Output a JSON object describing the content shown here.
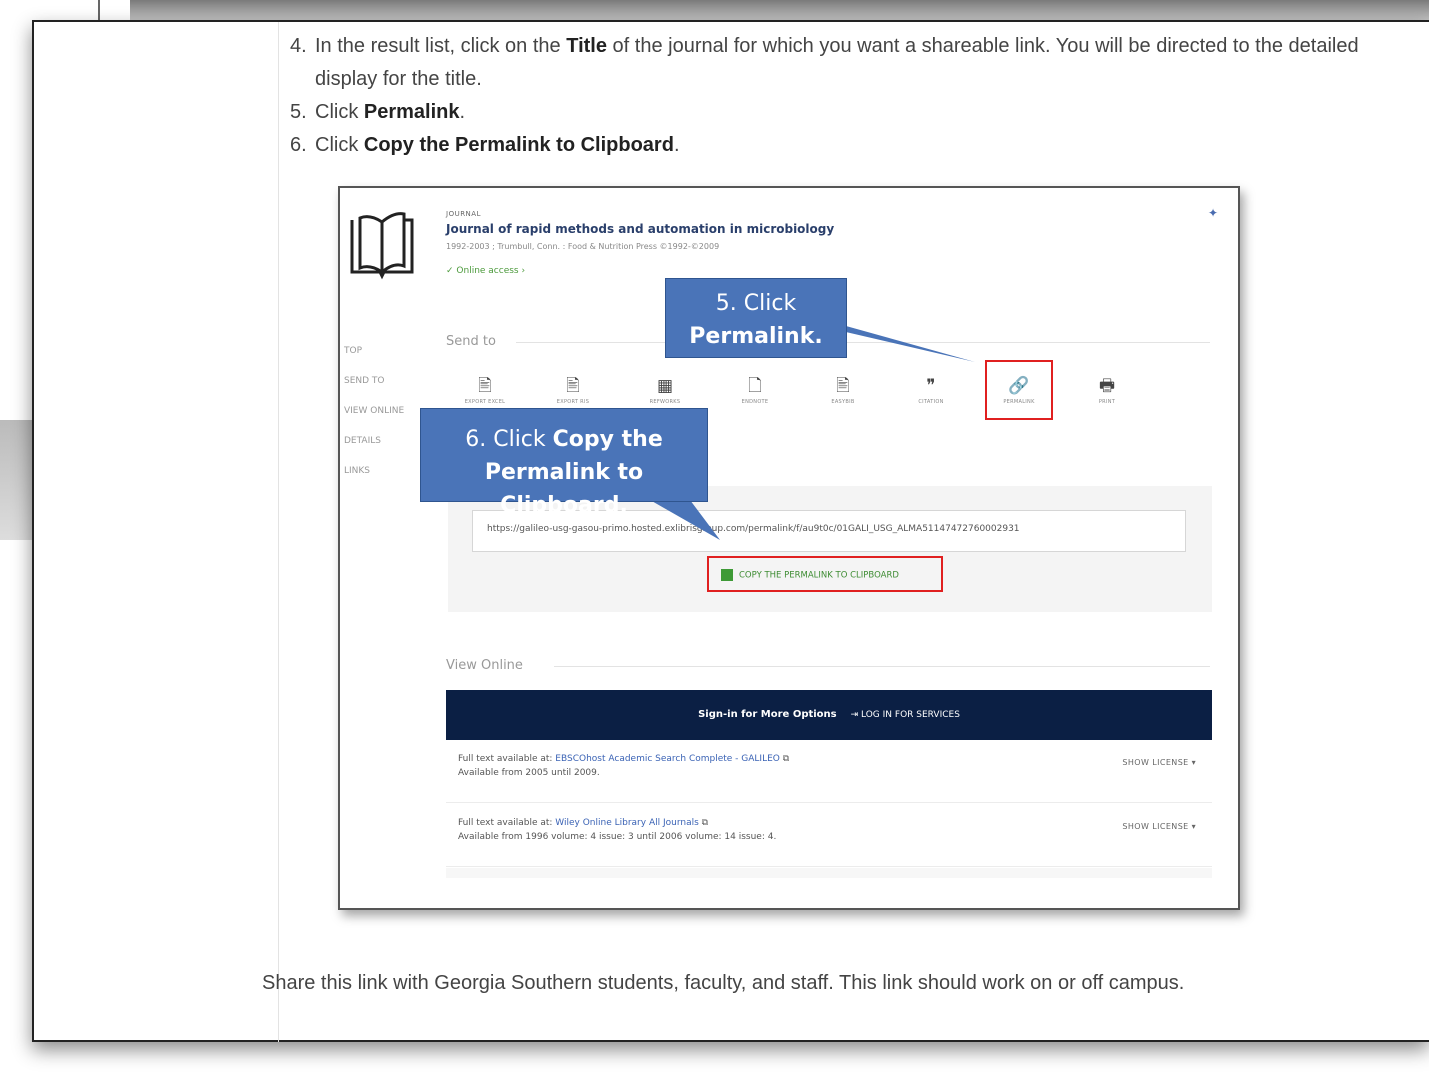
{
  "steps": [
    {
      "num": "4.",
      "pre": "In the result list, click on the ",
      "bold": "Title",
      "post": " of the journal for which you want a shareable link. You will be directed to the detailed display for the title."
    },
    {
      "num": "5.",
      "pre": "Click ",
      "bold": "Permalink",
      "post": "."
    },
    {
      "num": "6.",
      "pre": "Click ",
      "bold": "Copy the Permalink to Clipboard",
      "post": "."
    }
  ],
  "share_text": "Share this link with Georgia Southern students, faculty, and staff. This link should work on or off campus.",
  "screenshot": {
    "journal_type": "JOURNAL",
    "journal_title": "Journal of rapid methods and automation in microbiology",
    "journal_pub": "1992-2003 ; Trumbull, Conn. : Food & Nutrition Press ©1992-©2009",
    "online_access": "✓ Online access  ›",
    "left_nav": [
      "TOP",
      "SEND TO",
      "VIEW ONLINE",
      "DETAILS",
      "LINKS"
    ],
    "send_to": "Send to",
    "tools": [
      {
        "icon": "🖹",
        "label": "EXPORT EXCEL"
      },
      {
        "icon": "🖹",
        "label": "EXPORT RIS"
      },
      {
        "icon": "▦",
        "label": "REFWORKS"
      },
      {
        "icon": "🗋",
        "label": "ENDNOTE"
      },
      {
        "icon": "🖹",
        "label": "EASYBIB"
      },
      {
        "icon": "❞",
        "label": "CITATION"
      },
      {
        "icon": "🔗",
        "label": "PERMALINK"
      },
      {
        "icon": "🖶",
        "label": "PRINT"
      }
    ],
    "permalink_url": "https://galileo-usg-gasou-primo.hosted.exlibrisgroup.com/permalink/f/au9t0c/01GALI_USG_ALMA51147472760002931",
    "copy_label": "COPY THE PERMALINK TO CLIPBOARD",
    "view_online": "View Online",
    "signin": "Sign-in for More Options",
    "login": "LOG IN FOR SERVICES",
    "fulltext": [
      {
        "prefix": "Full text available at: ",
        "link": "EBSCOhost Academic Search Complete - GALILEO",
        "avail": "Available from 2005 until 2009.",
        "license": "SHOW LICENSE"
      },
      {
        "prefix": "Full text available at: ",
        "link": "Wiley Online Library All Journals",
        "avail": "Available from 1996 volume: 4 issue: 3 until 2006 volume: 14 issue: 4.",
        "license": "SHOW LICENSE"
      }
    ]
  },
  "callout1": {
    "line1": "5. Click",
    "line2": "Permalink."
  },
  "callout2": {
    "pre": "6. Click ",
    "bold1": "Copy the",
    "line2": "Permalink to Clipboard."
  },
  "colors": {
    "callout": "#4a74b8",
    "highlight": "#e02020",
    "navbar": "#0b1f44"
  }
}
